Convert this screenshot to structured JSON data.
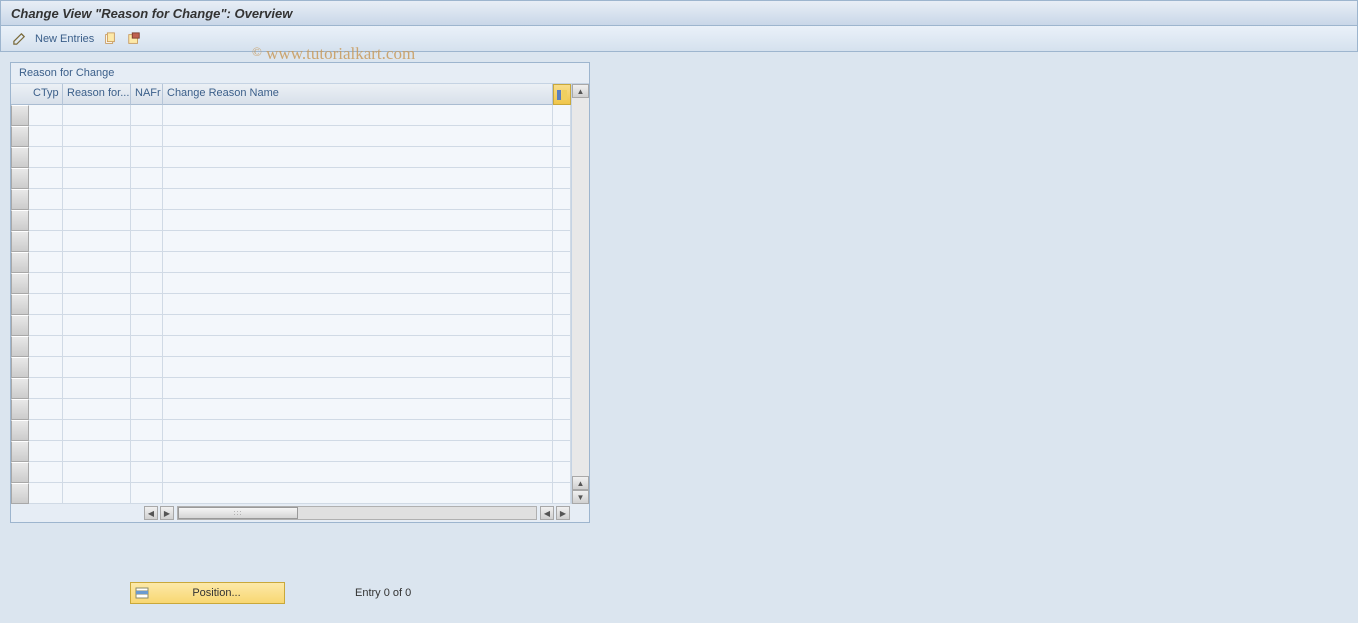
{
  "title": "Change View \"Reason for Change\": Overview",
  "toolbar": {
    "new_entries_label": "New Entries"
  },
  "panel": {
    "title": "Reason for Change"
  },
  "columns": {
    "ctyp": "CTyp",
    "reason_for": "Reason for...",
    "nafr": "NAFr",
    "change_reason_name": "Change Reason Name"
  },
  "rows": [],
  "footer": {
    "position_label": "Position...",
    "entry_status": "Entry 0 of 0"
  },
  "watermark": "www.tutorialkart.com"
}
